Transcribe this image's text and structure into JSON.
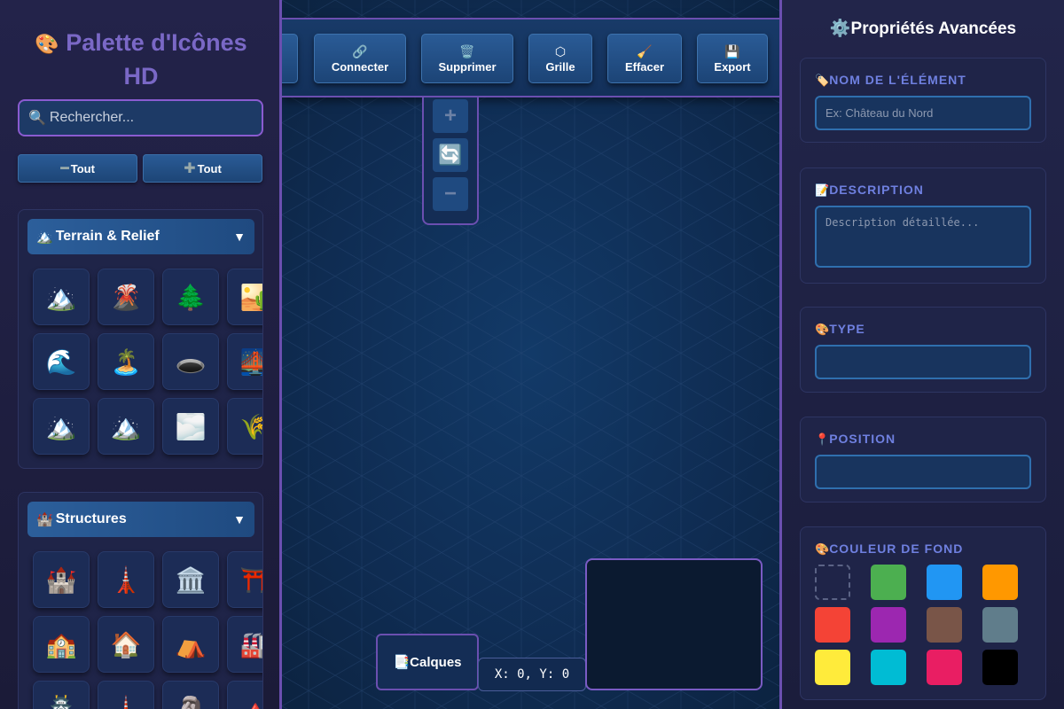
{
  "palette": {
    "title_icon": "🎨",
    "title": "Palette d'Icônes HD",
    "search_icon": "🔍",
    "search_placeholder": "Rechercher...",
    "collapse_all": "Tout",
    "expand_all": "Tout",
    "sections": [
      {
        "icon": "🏔️",
        "title": "Terrain & Relief",
        "chevron": "▼",
        "icons": [
          {
            "glyph": "🏔️",
            "name": "mountain-icon"
          },
          {
            "glyph": "🌋",
            "name": "volcano-icon"
          },
          {
            "glyph": "🌲",
            "name": "pine-tree-icon"
          },
          {
            "glyph": "🏜️",
            "name": "desert-icon"
          },
          {
            "glyph": "🌊",
            "name": "wave-icon"
          },
          {
            "glyph": "🏝️",
            "name": "island-icon"
          },
          {
            "glyph": "🕳️",
            "name": "hole-icon"
          },
          {
            "glyph": "🌉",
            "name": "bridge-icon"
          },
          {
            "glyph": "🏔️",
            "name": "mountain-icon"
          },
          {
            "glyph": "🏔️",
            "name": "mountain-icon"
          },
          {
            "glyph": "🌫️",
            "name": "fog-icon"
          },
          {
            "glyph": "🌾",
            "name": "wheat-icon"
          }
        ]
      },
      {
        "icon": "🏰",
        "title": "Structures",
        "chevron": "▼",
        "icons": [
          {
            "glyph": "🏰",
            "name": "castle-icon"
          },
          {
            "glyph": "🗼",
            "name": "tower-icon"
          },
          {
            "glyph": "🏛️",
            "name": "temple-icon"
          },
          {
            "glyph": "⛩️",
            "name": "torii-gate-icon"
          },
          {
            "glyph": "🏫",
            "name": "school-icon"
          },
          {
            "glyph": "🏠",
            "name": "house-icon"
          },
          {
            "glyph": "⛺",
            "name": "tent-icon"
          },
          {
            "glyph": "🏭",
            "name": "factory-icon"
          },
          {
            "glyph": "🏯",
            "name": "japanese-castle-icon"
          },
          {
            "glyph": "🗼",
            "name": "tower-icon"
          },
          {
            "glyph": "🗿",
            "name": "statue-icon"
          },
          {
            "glyph": "🔺",
            "name": "pyramid-icon"
          }
        ]
      }
    ]
  },
  "toolbar": {
    "buttons": [
      {
        "icon": "🔗",
        "label": "Connecter",
        "name": "connect-button"
      },
      {
        "icon": "🗑️",
        "label": "Supprimer",
        "name": "delete-button"
      },
      {
        "icon": "⬡",
        "label": "Grille",
        "name": "grid-button"
      },
      {
        "icon": "🧹",
        "label": "Effacer",
        "name": "clear-button"
      },
      {
        "icon": "💾",
        "label": "Export",
        "name": "export-button"
      }
    ]
  },
  "zoom": {
    "zoom_in": "+",
    "reset": "🔄",
    "zoom_out": "−"
  },
  "layers": {
    "icon": "📑",
    "label": "Calques"
  },
  "coordinates": "X: 0, Y: 0",
  "properties": {
    "title_icon": "⚙️",
    "title": "Propriétés Avancées",
    "name": {
      "icon": "🏷️",
      "label": "NOM DE L'ÉLÉMENT",
      "placeholder": "Ex: Château du Nord"
    },
    "description": {
      "icon": "📝",
      "label": "DESCRIPTION",
      "placeholder": "Description détaillée..."
    },
    "type": {
      "icon": "🎨",
      "label": "TYPE",
      "value": ""
    },
    "position": {
      "icon": "📍",
      "label": "POSITION",
      "value": ""
    },
    "background": {
      "icon": "🎨",
      "label": "COULEUR DE FOND",
      "colors": [
        "transparent",
        "#4caf50",
        "#2196f3",
        "#ff9800",
        "#f44336",
        "#9c27b0",
        "#795548",
        "#607d8b",
        "#ffeb3b",
        "#00bcd4",
        "#e91e63",
        "#000000"
      ]
    }
  }
}
